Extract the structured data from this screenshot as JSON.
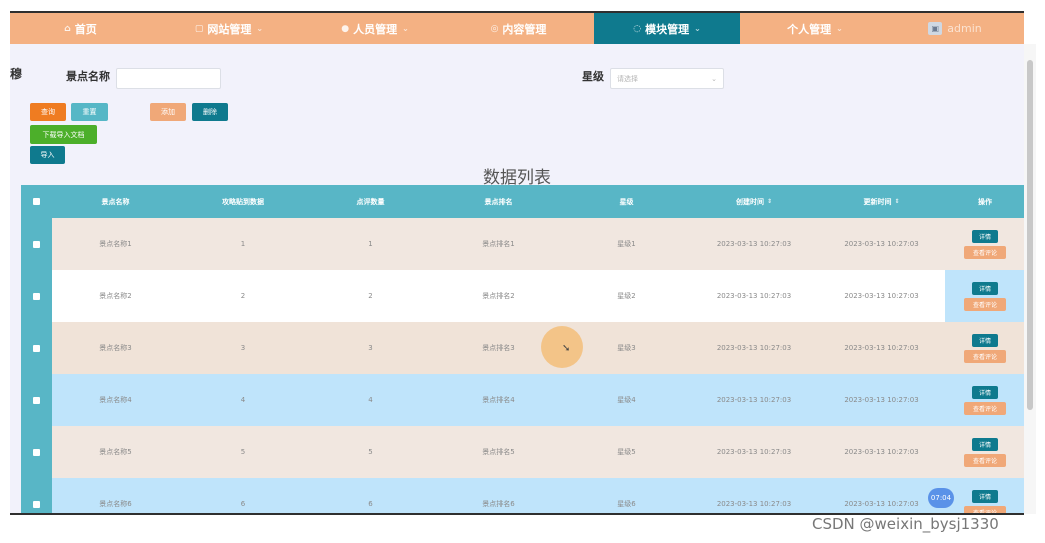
{
  "nav": {
    "items": [
      {
        "label": "首页",
        "icon": "home-icon",
        "glyph": "⌂",
        "chevron": ""
      },
      {
        "label": "网站管理",
        "icon": "site-icon",
        "glyph": "▢",
        "chevron": "⌄"
      },
      {
        "label": "人员管理",
        "icon": "user-icon",
        "glyph": "●",
        "chevron": "⌄"
      },
      {
        "label": "内容管理",
        "icon": "content-icon",
        "glyph": "◎",
        "chevron": ""
      },
      {
        "label": "模块管理",
        "icon": "module-icon",
        "glyph": "◌",
        "chevron": "⌄"
      },
      {
        "label": "个人管理",
        "icon": "profile-icon",
        "glyph": "",
        "chevron": "⌄"
      }
    ],
    "active_index": 4,
    "user": "admin"
  },
  "breadcrumb": "穆",
  "search": {
    "name_label": "景点名称",
    "name_value": "",
    "star_label": "星级",
    "star_placeholder": "请选择"
  },
  "buttons": {
    "query": "查询",
    "reset": "重置",
    "add": "添加",
    "delete": "删除",
    "download": "下载导入文档",
    "import": "导入"
  },
  "table": {
    "title": "数据列表",
    "columns": [
      "景点名称",
      "攻略贴到数据",
      "点评数量",
      "景点排名",
      "星级",
      "创建时间",
      "更新时间",
      "操作"
    ],
    "sortable_cols": [
      5,
      6
    ],
    "detail_label": "详情",
    "review_label": "查看评论",
    "rows": [
      {
        "name": "景点名称1",
        "guides": "1",
        "reviews": "1",
        "rank": "景点排名1",
        "star": "星级1",
        "created": "2023-03-13 10:27:03",
        "updated": "2023-03-13 10:27:03"
      },
      {
        "name": "景点名称2",
        "guides": "2",
        "reviews": "2",
        "rank": "景点排名2",
        "star": "星级2",
        "created": "2023-03-13 10:27:03",
        "updated": "2023-03-13 10:27:03"
      },
      {
        "name": "景点名称3",
        "guides": "3",
        "reviews": "3",
        "rank": "景点排名3",
        "star": "星级3",
        "created": "2023-03-13 10:27:03",
        "updated": "2023-03-13 10:27:03"
      },
      {
        "name": "景点名称4",
        "guides": "4",
        "reviews": "4",
        "rank": "景点排名4",
        "star": "星级4",
        "created": "2023-03-13 10:27:03",
        "updated": "2023-03-13 10:27:03"
      },
      {
        "name": "景点名称5",
        "guides": "5",
        "reviews": "5",
        "rank": "景点排名5",
        "star": "星级5",
        "created": "2023-03-13 10:27:03",
        "updated": "2023-03-13 10:27:03"
      },
      {
        "name": "景点名称6",
        "guides": "6",
        "reviews": "6",
        "rank": "景点排名6",
        "star": "星级6",
        "created": "2023-03-13 10:27:03",
        "updated": "2023-03-13 10:27:03"
      }
    ]
  },
  "time_badge": "07:04",
  "watermark": "CSDN @weixin_bysj1330",
  "colors": {
    "nav_bg": "#f4b183",
    "nav_active": "#0f7a8e",
    "table_header": "#58b6c6",
    "highlight_row": "#bfe4fb"
  }
}
